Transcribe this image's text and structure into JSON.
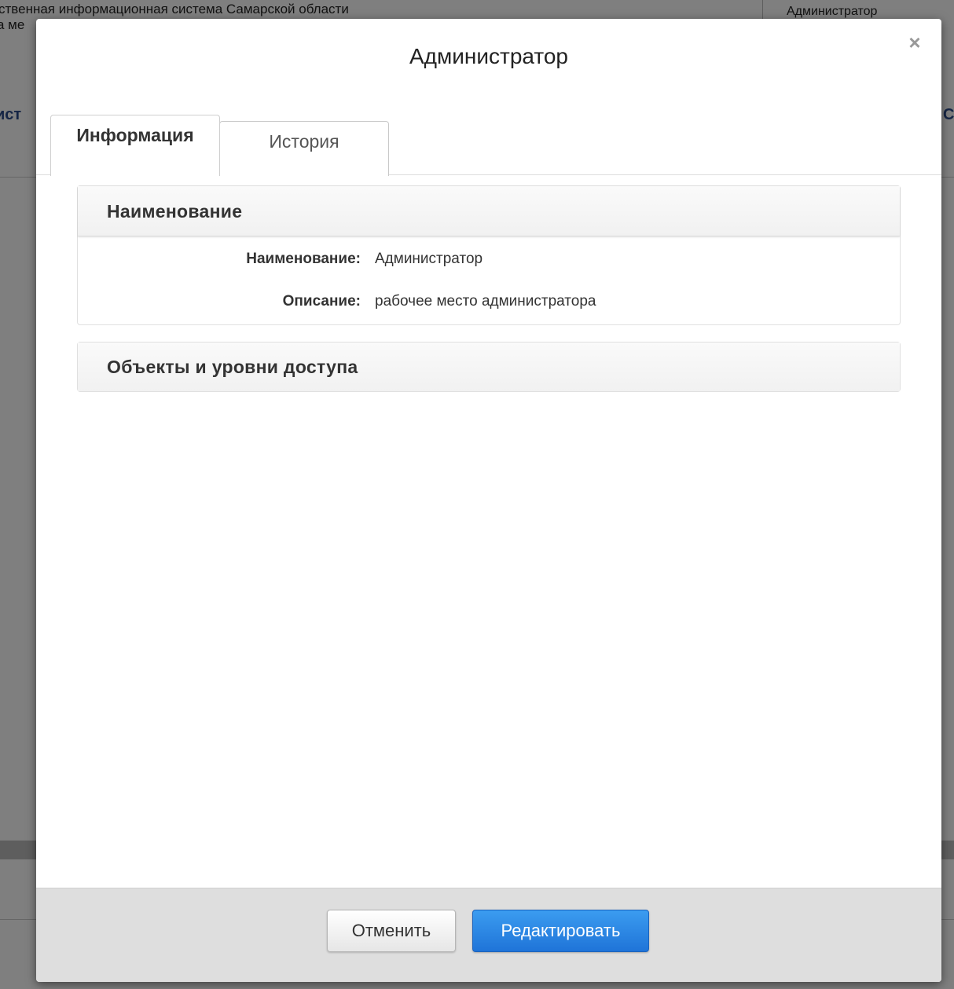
{
  "background": {
    "app_title": "ственная информационная система Самарской области",
    "subtitle": "а ме",
    "user": "Администратор",
    "nav_left": "ист",
    "nav_right": "С"
  },
  "modal": {
    "title": "Администратор",
    "close_label": "×",
    "tabs": [
      {
        "label": "Информация",
        "active": true
      },
      {
        "label": "История",
        "active": false
      }
    ],
    "sections": {
      "name": {
        "header": "Наименование",
        "fields": [
          {
            "label": "Наименование:",
            "value": "Администратор"
          },
          {
            "label": "Описание:",
            "value": "рабочее место администратора"
          }
        ]
      },
      "access": {
        "header": "Объекты и уровни доступа"
      }
    },
    "footer": {
      "cancel_label": "Отменить",
      "edit_label": "Редактировать"
    }
  },
  "colors": {
    "primary": "#1f74d8",
    "overlay": "#000000"
  }
}
